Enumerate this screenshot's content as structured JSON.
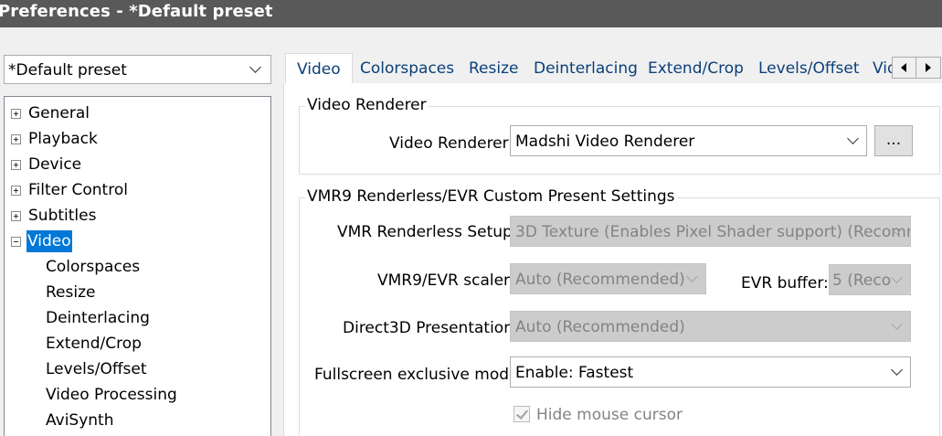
{
  "window": {
    "title": "Preferences - *Default preset"
  },
  "preset": {
    "selected": "*Default preset"
  },
  "tree": {
    "items": [
      {
        "label": "General",
        "expander": "plus"
      },
      {
        "label": "Playback",
        "expander": "plus"
      },
      {
        "label": "Device",
        "expander": "plus"
      },
      {
        "label": "Filter Control",
        "expander": "plus"
      },
      {
        "label": "Subtitles",
        "expander": "plus"
      },
      {
        "label": "Video",
        "expander": "minus",
        "selected": true
      },
      {
        "label": "Colorspaces"
      },
      {
        "label": "Resize"
      },
      {
        "label": "Deinterlacing"
      },
      {
        "label": "Extend/Crop"
      },
      {
        "label": "Levels/Offset"
      },
      {
        "label": "Video Processing"
      },
      {
        "label": "AviSynth"
      }
    ]
  },
  "tabs": [
    "Video",
    "Colorspaces",
    "Resize",
    "Deinterlacing",
    "Extend/Crop",
    "Levels/Offset",
    "Vid"
  ],
  "video_renderer_group": {
    "legend": "Video Renderer",
    "renderer_label": "Video Renderer:",
    "renderer_value": "Madshi Video Renderer",
    "settings_button": "..."
  },
  "vmr9_group": {
    "legend": "VMR9 Renderless/EVR Custom Present Settings",
    "renderless_setup_label": "VMR Renderless Setup:",
    "renderless_setup_value": "3D Texture (Enables Pixel Shader support) (Recomm",
    "scaler_label": "VMR9/EVR scaler:",
    "scaler_value": "Auto (Recommended)",
    "evr_buffer_label": "EVR buffer:",
    "evr_buffer_value": "5 (Reco",
    "d3d_label": "Direct3D Presentation:",
    "d3d_value": "Auto (Recommended)",
    "fullscreen_label": "Fullscreen exclusive mode:",
    "fullscreen_value": "Enable: Fastest",
    "hide_cursor_label": "Hide mouse cursor",
    "hide_cursor_checked": true
  },
  "colors": {
    "selection": "#0078d7",
    "titlebar": "#595959",
    "tab_text": "#0b3f7a",
    "disabled_bg": "#cccccc"
  }
}
